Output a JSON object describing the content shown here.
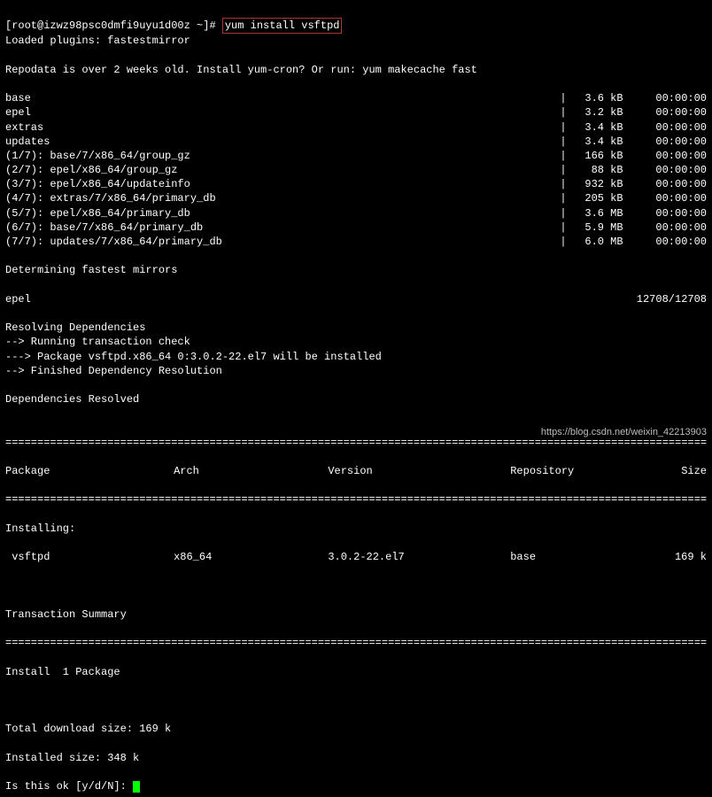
{
  "prompt_prefix": "[root@izwz98psc0dmfi9uyu1d00z ~]# ",
  "command": "yum install vsftpd",
  "lines_top": [
    "Loaded plugins: fastestmirror",
    "Repodata is over 2 weeks old. Install yum-cron? Or run: yum makecache fast"
  ],
  "downloads": [
    {
      "name": "base",
      "size": "3.6 kB",
      "time": "00:00:00"
    },
    {
      "name": "epel",
      "size": "3.2 kB",
      "time": "00:00:00"
    },
    {
      "name": "extras",
      "size": "3.4 kB",
      "time": "00:00:00"
    },
    {
      "name": "updates",
      "size": "3.4 kB",
      "time": "00:00:00"
    },
    {
      "name": "(1/7): base/7/x86_64/group_gz",
      "size": "166 kB",
      "time": "00:00:00"
    },
    {
      "name": "(2/7): epel/x86_64/group_gz",
      "size": "88 kB",
      "time": "00:00:00"
    },
    {
      "name": "(3/7): epel/x86_64/updateinfo",
      "size": "932 kB",
      "time": "00:00:00"
    },
    {
      "name": "(4/7): extras/7/x86_64/primary_db",
      "size": "205 kB",
      "time": "00:00:00"
    },
    {
      "name": "(5/7): epel/x86_64/primary_db",
      "size": "3.6 MB",
      "time": "00:00:00"
    },
    {
      "name": "(6/7): base/7/x86_64/primary_db",
      "size": "5.9 MB",
      "time": "00:00:00"
    },
    {
      "name": "(7/7): updates/7/x86_64/primary_db",
      "size": "6.0 MB",
      "time": "00:00:00"
    }
  ],
  "mirrors": {
    "determining": "Determining fastest mirrors",
    "epel_label": "epel",
    "epel_count": "12708/12708"
  },
  "resolve_lines": [
    "Resolving Dependencies",
    "--> Running transaction check",
    "---> Package vsftpd.x86_64 0:3.0.2-22.el7 will be installed",
    "--> Finished Dependency Resolution",
    "",
    "Dependencies Resolved",
    ""
  ],
  "hr": "================================================================================================================",
  "table": {
    "headers": {
      "c1": "Package",
      "c2": "Arch",
      "c3": "Version",
      "c4": "Repository",
      "c5": "Size"
    },
    "installing_label": "Installing:",
    "row": {
      "c1": " vsftpd",
      "c2": "x86_64",
      "c3": "3.0.2-22.el7",
      "c4": "base",
      "c5": "169 k"
    }
  },
  "summary": {
    "title": "Transaction Summary",
    "install": "Install  1 Package",
    "total": "Total download size: 169 k",
    "installed": "Installed size: 348 k",
    "confirm": "Is this ok [y/d/N]: "
  },
  "watermark": "https://blog.csdn.net/weixin_42213903"
}
